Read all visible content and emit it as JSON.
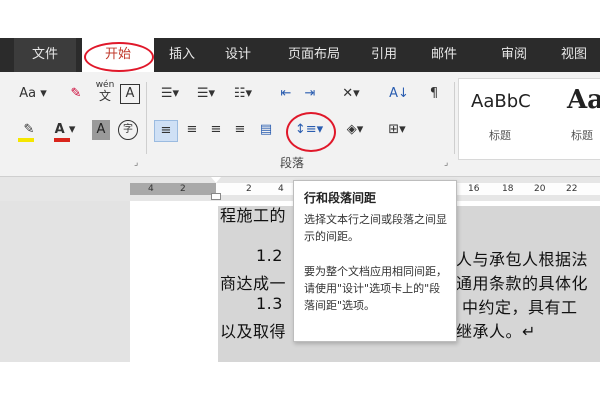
{
  "menu": {
    "tabs": [
      "文件",
      "开始",
      "插入",
      "设计",
      "页面布局",
      "引用",
      "邮件",
      "审阅",
      "视图"
    ],
    "active": "开始"
  },
  "ribbon": {
    "font_size_btn": "Aa",
    "pinyin_top": "wén",
    "pinyin_bottom": "文",
    "border_char": "A",
    "font_color_char": "A",
    "shade_char": "A",
    "enclosed_char": "字",
    "sort_label": "A↓",
    "paragraph_group_label": "段落",
    "line_spacing_button": "↕≡",
    "styles": [
      {
        "sample": "AaBbC",
        "label": "标题"
      },
      {
        "sample": "Aa",
        "label": "标题"
      }
    ],
    "colors": {
      "highlight": "#f5e600",
      "font_red": "#d9251c",
      "accent_red": "#e0182a"
    }
  },
  "ruler": {
    "ticks": [
      "4",
      "2",
      "2",
      "4",
      "16",
      "18",
      "20",
      "22"
    ]
  },
  "document": {
    "lines": [
      "程施工的",
      "1.2",
      "人与承包人根据法",
      "商达成一",
      "通用条款的具体化",
      "1.3",
      "中约定，具有工",
      "以及取得",
      "继承人。↵"
    ]
  },
  "tooltip": {
    "title": "行和段落间距",
    "description": "选择文本行之间或段落之间显示的间距。",
    "hint": "要为整个文档应用相同间距，请使用\"设计\"选项卡上的\"段落间距\"选项。"
  }
}
